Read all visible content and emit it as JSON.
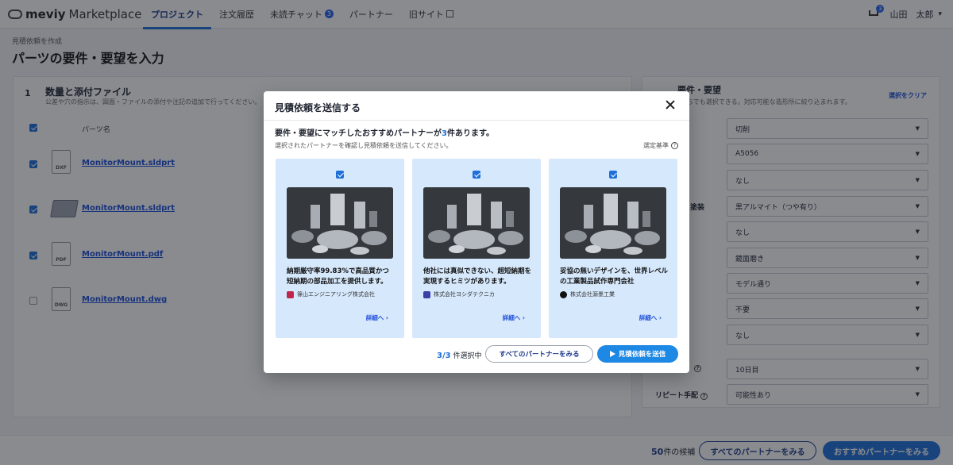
{
  "header": {
    "brand": "meviy",
    "brand_sub": "Marketplace",
    "nav": [
      {
        "label": "プロジェクト"
      },
      {
        "label": "注文履歴"
      },
      {
        "label": "未読チャット",
        "badge": "3"
      },
      {
        "label": "パートナー"
      },
      {
        "label": "旧サイト"
      }
    ],
    "cart_badge": "3",
    "user": "山田　太郎"
  },
  "page": {
    "breadcrumb": "見積依頼を作成",
    "title": "パーツの要件・要望を入力"
  },
  "left": {
    "step": "1",
    "title": "数量と添付ファイル",
    "subtitle": "公差や穴の指示は、図面・ファイルの添付や注記の追加で行ってください。",
    "column_header": "パーツ名",
    "files": [
      {
        "type": "DXF",
        "name": "MonitorMount.sldprt",
        "checked": true
      },
      {
        "type": "",
        "name": "MonitorMount.sldprt",
        "checked": true
      },
      {
        "type": "PDF",
        "name": "MonitorMount.pdf",
        "checked": true
      },
      {
        "type": "DWG",
        "name": "MonitorMount.dwg",
        "checked": false
      }
    ]
  },
  "right": {
    "title": "要件・要望",
    "subtitle": "選択肢からでも選択できる。対応可能な造形所に絞り込まれます。",
    "clear": "選択をクリア",
    "selects": [
      "切削",
      "A5056",
      "なし",
      "黒アルマイト（つや有り）",
      "なし",
      "鏡面磨き",
      "モデル通り",
      "不要",
      "なし",
      "10日目",
      "可能性あり"
    ],
    "label_coat": "塗装",
    "label_repeat": "リピート手配"
  },
  "footer": {
    "count": "50",
    "count_suffix": "件の候補",
    "btn_all": "すべてのパートナーをみる",
    "btn_rec": "おすすめパートナーをみる"
  },
  "modal": {
    "title": "見積依頼を送信する",
    "lead_prefix": "要件・要望にマッチしたおすすめパートナーが",
    "lead_num": "3",
    "lead_suffix": "件あります。",
    "sub": "選択されたパートナーを確認し見積依頼を送信してください。",
    "criteria": "選定基準",
    "cards": [
      {
        "desc": "納期厳守率99.83%で高品質かつ短納期の部品加工を提供します。",
        "company": "篠山エンジニアリング株式会社",
        "detail": "詳細へ ›",
        "logo_color": "#c0264b"
      },
      {
        "desc": "他社には真似できない、超短納期を実現するヒミツがあります。",
        "company": "株式会社ヨシダテクニカ",
        "detail": "詳細へ ›",
        "logo_color": "#3b3fa8"
      },
      {
        "desc": "妥協の無いデザインを、世界レベルの工業製品試作専門会社",
        "company": "株式会社源墨工業",
        "detail": "詳細へ ›",
        "logo_color": "#111111"
      }
    ],
    "selected_num": "3/3",
    "selected_suffix": "件選択中",
    "btn_all": "すべてのパートナーをみる",
    "btn_send": "見積依頼を送信"
  }
}
